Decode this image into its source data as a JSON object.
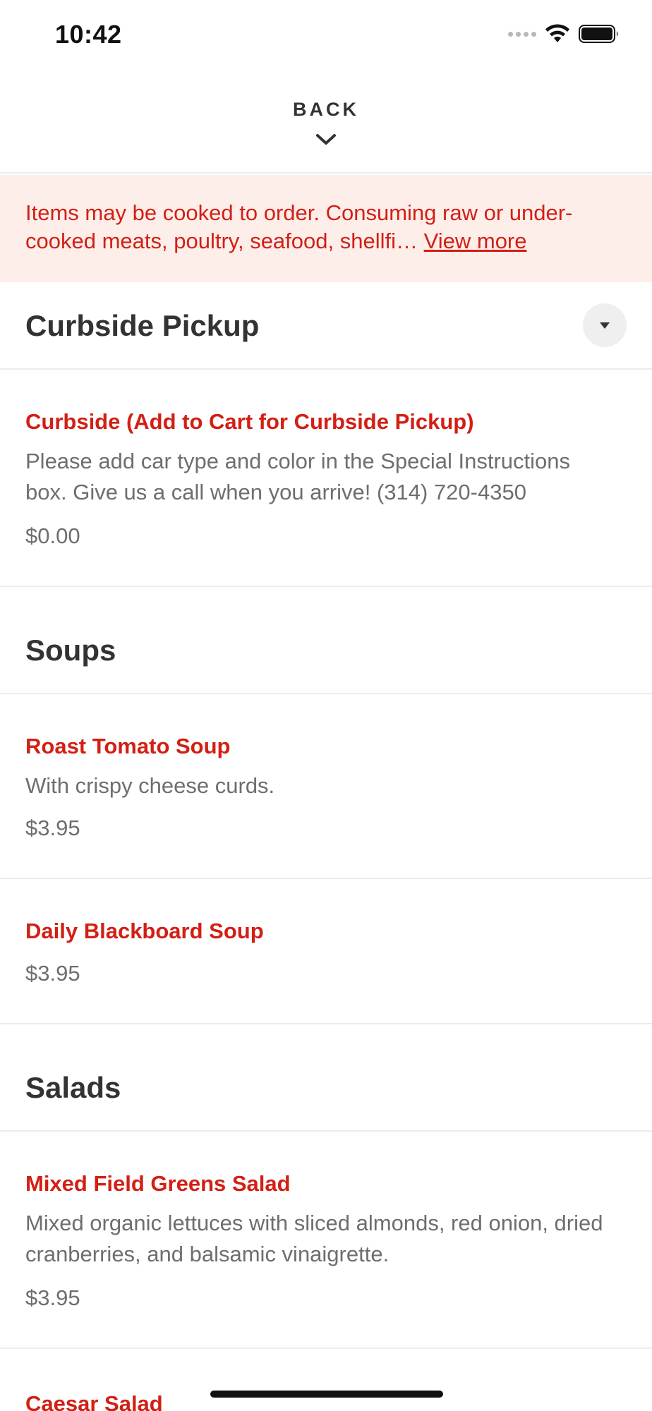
{
  "status_bar": {
    "time": "10:42",
    "icons": [
      "cellular-signal-icon",
      "wifi-icon",
      "battery-icon"
    ]
  },
  "header": {
    "back_label": "BACK",
    "back_icon": "chevron-down-icon"
  },
  "notice": {
    "text": "Items may be cooked to order. Consuming raw or under-cooked meats, poultry, seafood, shellfi…",
    "link_label": "View more"
  },
  "colors": {
    "accent": "#d31f14",
    "notice_bg": "#fdeeea",
    "heading": "#333333",
    "muted": "#6e6e6e",
    "divider": "#ececec"
  },
  "sections": {
    "curbside": {
      "title": "Curbside Pickup",
      "dropdown_icon": "caret-down-icon",
      "items": [
        {
          "name": "Curbside (Add to Cart for Curbside Pickup)",
          "description": "Please add car type and color in the Special Instructions box. Give us a call when you arrive! (314) 720-4350",
          "price": "$0.00"
        }
      ]
    },
    "soups": {
      "title": "Soups",
      "items": [
        {
          "name": "Roast Tomato Soup",
          "description": "With crispy cheese curds.",
          "price": "$3.95"
        },
        {
          "name": "Daily Blackboard Soup",
          "price": "$3.95"
        }
      ]
    },
    "salads": {
      "title": "Salads",
      "items": [
        {
          "name": "Mixed Field Greens Salad",
          "description": "Mixed organic lettuces with sliced almonds, red onion, dried cranberries, and balsamic vinaigrette.",
          "price": "$3.95"
        },
        {
          "name": "Caesar Salad"
        }
      ]
    }
  }
}
